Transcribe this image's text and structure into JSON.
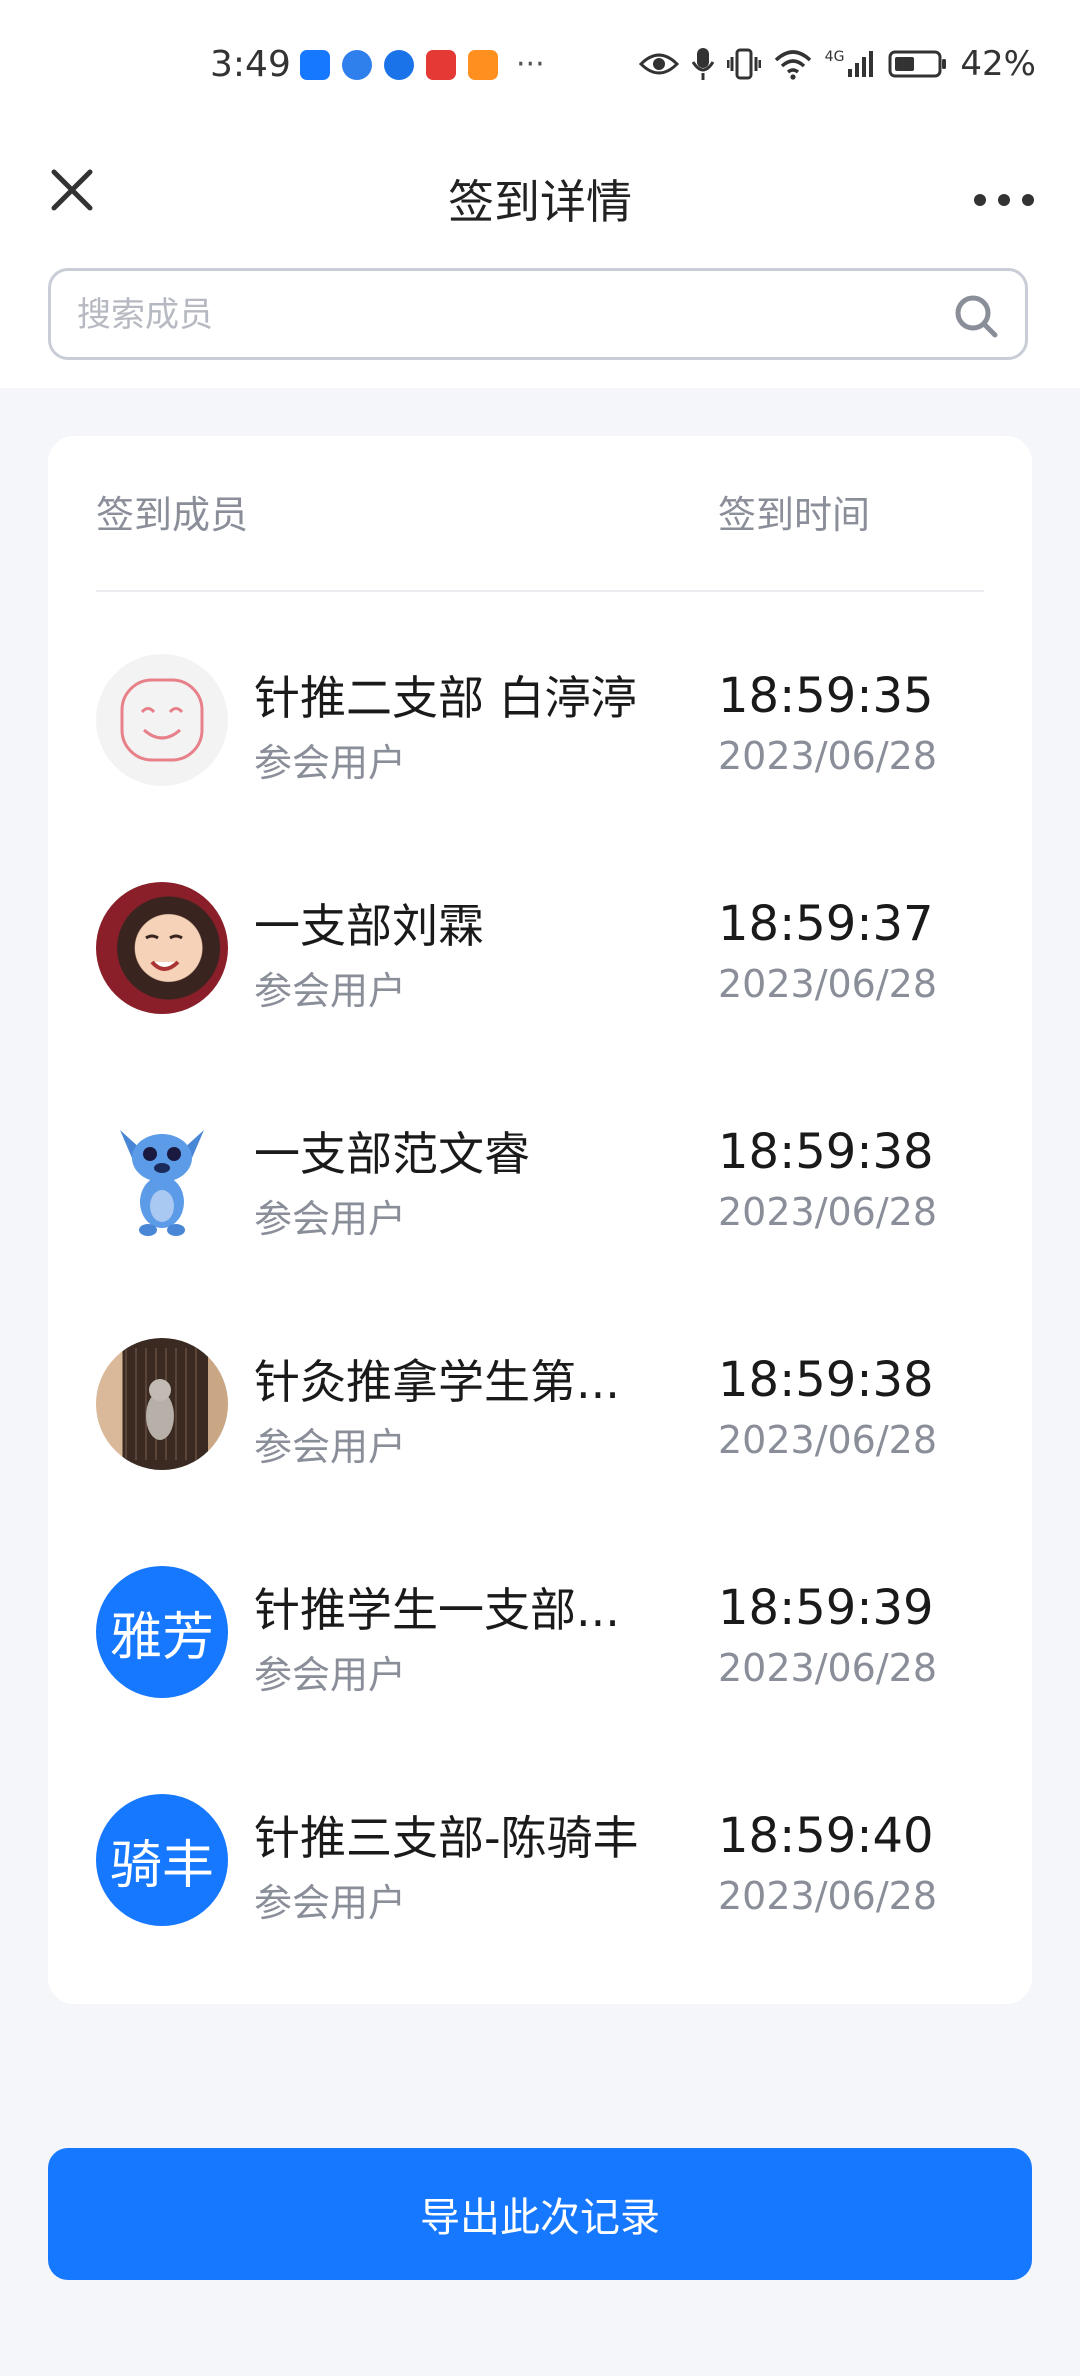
{
  "status_bar": {
    "time": "3:49",
    "more": "···",
    "network": "4G",
    "battery": "42%",
    "app_icons": [
      "meet-app-icon",
      "browser-app-icon",
      "edge-app-icon",
      "huawei-app-icon",
      "video-app-icon"
    ],
    "app_colors": [
      "#1677ff",
      "#2f80ed",
      "#1a73e8",
      "#e53935",
      "#ff8f1f"
    ]
  },
  "nav": {
    "title": "签到详情"
  },
  "search": {
    "placeholder": "搜索成员"
  },
  "table": {
    "col_member": "签到成员",
    "col_time": "签到时间",
    "rows": [
      {
        "name": "针推二支部 白渟渟",
        "role": "参会用户",
        "time": "18:59:35",
        "date": "2023/06/28",
        "avatar": "smiley-avatar"
      },
      {
        "name": "一支部刘霖",
        "role": "参会用户",
        "time": "18:59:37",
        "date": "2023/06/28",
        "avatar": "child-photo-avatar"
      },
      {
        "name": "一支部范文睿",
        "role": "参会用户",
        "time": "18:59:38",
        "date": "2023/06/28",
        "avatar": "stitch-cartoon-avatar"
      },
      {
        "name": "针灸推拿学生第...",
        "role": "参会用户",
        "time": "18:59:38",
        "date": "2023/06/28",
        "avatar": "cat-photo-avatar"
      },
      {
        "name": "针推学生一支部...",
        "role": "参会用户",
        "time": "18:59:39",
        "date": "2023/06/28",
        "avatar_text": "雅芳"
      },
      {
        "name": "针推三支部-陈骑丰",
        "role": "参会用户",
        "time": "18:59:40",
        "date": "2023/06/28",
        "avatar_text": "骑丰"
      }
    ]
  },
  "export_button": "导出此次记录",
  "colors": {
    "accent": "#1677ff",
    "background": "#f5f6fa",
    "muted_text": "#8a8e99"
  }
}
